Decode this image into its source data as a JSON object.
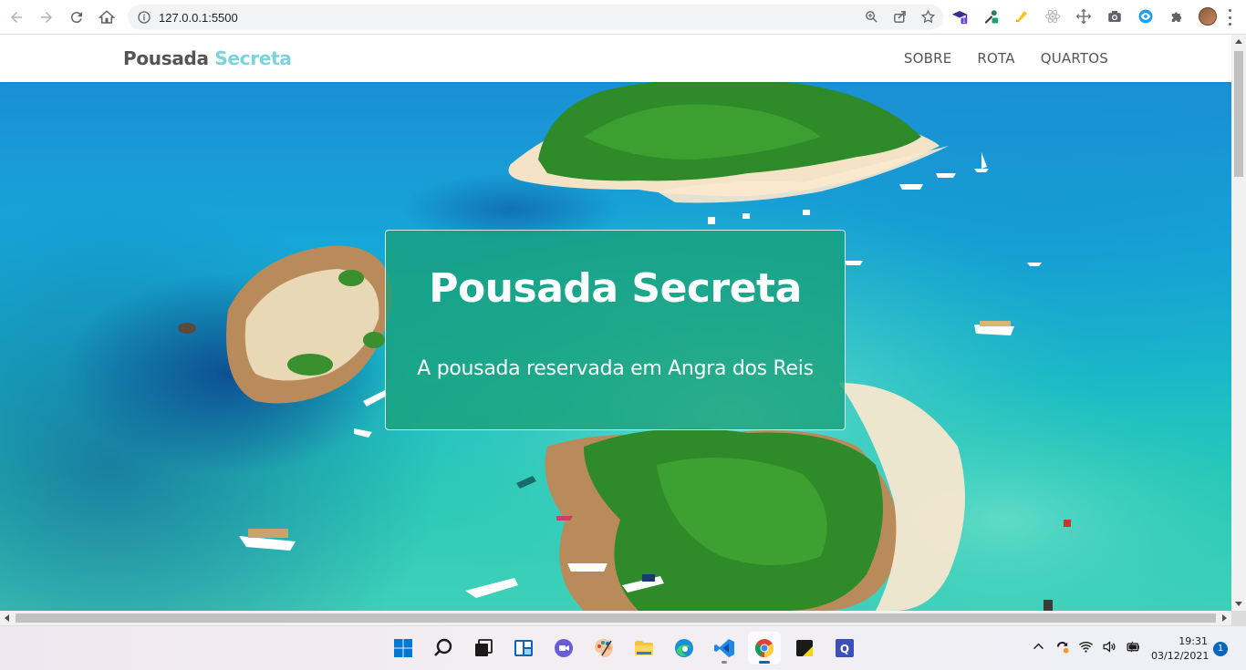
{
  "browser": {
    "url": "127.0.0.1:5500",
    "extensions": [
      "graduation-cap-extension",
      "eyedropper-extension",
      "highlighter-extension",
      "react-devtools-extension",
      "move-extension",
      "camera-extension",
      "eye-extension",
      "puzzle-extension"
    ],
    "ext_badges": {
      "graduation": "1"
    }
  },
  "site": {
    "brand_main": "Pousada",
    "brand_accent": "Secreta",
    "brand_accent_color": "#7dd3d8",
    "nav": [
      "SOBRE",
      "ROTA",
      "QUARTOS"
    ]
  },
  "hero": {
    "title": "Pousada Secreta",
    "subtitle": "A pousada reservada em Angra dos Reis",
    "overlay_color": "#18a078"
  },
  "taskbar": {
    "apps": [
      "windows-start",
      "search",
      "task-view",
      "widgets",
      "chat",
      "paint",
      "file-explorer",
      "edge",
      "vscode",
      "chrome",
      "sticky-notes",
      "q-app"
    ],
    "time": "19:31",
    "date": "03/12/2021",
    "notifications": "1"
  }
}
